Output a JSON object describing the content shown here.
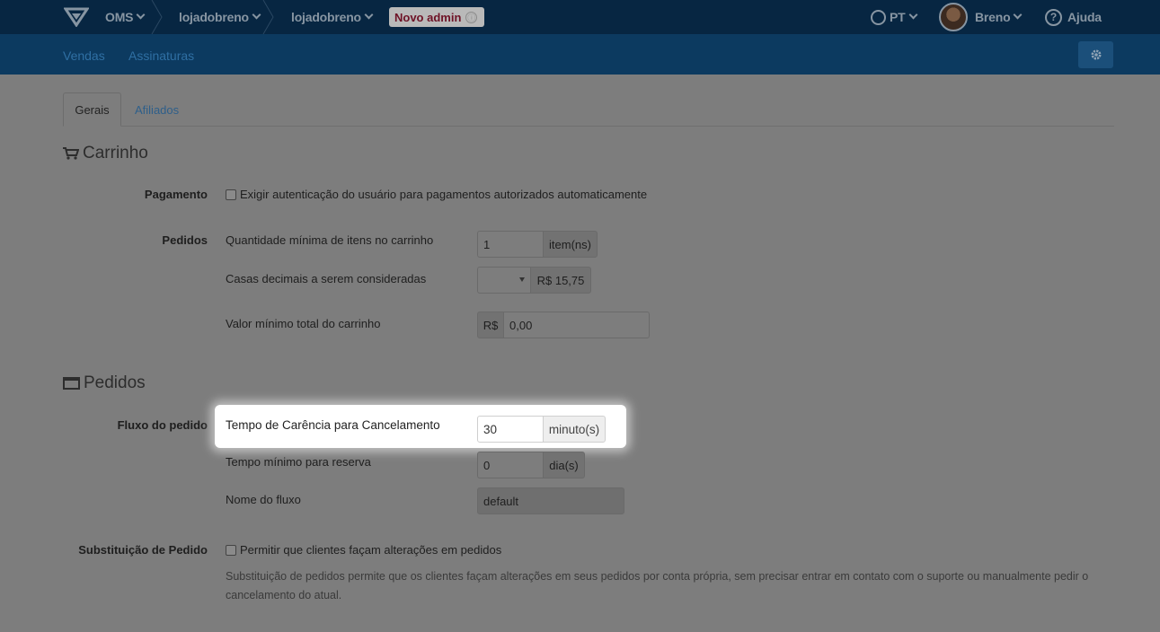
{
  "header": {
    "app": "OMS",
    "store_1": "lojadobreno",
    "store_2": "lojadobreno",
    "badge": "Novo admin",
    "badge_info_icon": "ⓘ",
    "language": "PT",
    "user": "Breno",
    "help": "Ajuda",
    "help_icon_glyph": "?"
  },
  "subnav": {
    "sales": "Vendas",
    "subscriptions": "Assinaturas"
  },
  "tabs": {
    "general": "Gerais",
    "affiliates": "Afiliados"
  },
  "cart": {
    "title": "Carrinho",
    "payment_label": "Pagamento",
    "payment_checkbox": "Exigir autenticação do usuário para pagamentos autorizados automaticamente",
    "orders_label": "Pedidos",
    "min_items_label": "Quantidade mínima de itens no carrinho",
    "min_items_value": "1",
    "min_items_unit": "item(ns)",
    "decimals_label": "Casas decimais a serem consideradas",
    "decimals_value": "",
    "decimals_example": "R$ 15,75",
    "min_total_label": "Valor mínimo total do carrinho",
    "min_total_prefix": "R$",
    "min_total_value": "0,00"
  },
  "orders": {
    "title": "Pedidos",
    "flow_label": "Fluxo do pedido",
    "grace_label": "Tempo de Carência para Cancelamento",
    "grace_value": "30",
    "grace_unit": "minuto(s)",
    "reserve_label": "Tempo mínimo para reserva",
    "reserve_value": "0",
    "reserve_unit": "dia(s)",
    "flow_name_label": "Nome do fluxo",
    "flow_name_value": "default",
    "replace_label": "Substituição de Pedido",
    "replace_checkbox": "Permitir que clientes façam alterações em pedidos",
    "replace_help": "Substituição de pedidos permite que os clientes façam alterações em seus pedidos por conta própria, sem precisar entrar em contato com o suporte ou manualmente pedir o cancelamento do atual."
  },
  "colors": {
    "topbar": "#072642",
    "subbar": "#0c3a60",
    "overlay": "#7d7d7d",
    "badge_text": "#6e1226"
  }
}
